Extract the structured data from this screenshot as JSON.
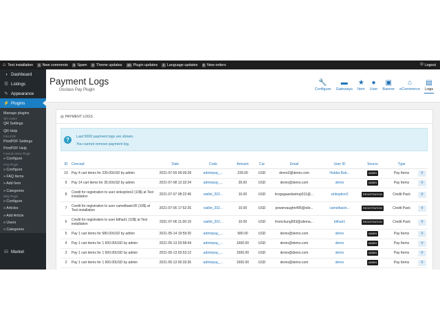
{
  "admin_bar": {
    "site": "Test installation",
    "items": [
      {
        "count": "1",
        "label": "New comments"
      },
      {
        "count": "3",
        "label": "Spam"
      },
      {
        "count": "4",
        "label": "Theme updates"
      },
      {
        "count": "10",
        "label": "Plugin updates"
      },
      {
        "count": "2",
        "label": "Language updates"
      },
      {
        "count": "5",
        "label": "New orders"
      }
    ],
    "logout": "Logout"
  },
  "sidebar": {
    "dashboard": "Dashboard",
    "listings": "Listings",
    "appearance": "Appearance",
    "plugins": "Plugins",
    "submenu": [
      {
        "type": "link",
        "label": "Manage plugins"
      },
      {
        "type": "head",
        "label": "QR Codes"
      },
      {
        "type": "link",
        "label": "QR Settings"
      },
      {
        "type": "link",
        "label": "QR Help"
      },
      {
        "type": "head",
        "label": "Print PDF"
      },
      {
        "type": "link",
        "label": "PrintPDF Settings"
      },
      {
        "type": "link",
        "label": "PrintPDF Help"
      },
      {
        "type": "head",
        "label": "Favorite Items Plugin"
      },
      {
        "type": "link",
        "label": "» Configure"
      },
      {
        "type": "head",
        "label": "FAQ Plugin"
      },
      {
        "type": "link",
        "label": "» Configure"
      },
      {
        "type": "link",
        "label": "» FAQ Items"
      },
      {
        "type": "link",
        "label": "» Add Item"
      },
      {
        "type": "link",
        "label": "» Categories"
      },
      {
        "type": "head",
        "label": "Blog Plugin"
      },
      {
        "type": "link",
        "label": "» Configure"
      },
      {
        "type": "link",
        "label": "» Articles"
      },
      {
        "type": "link",
        "label": "» Add Article"
      },
      {
        "type": "link",
        "label": "» Users"
      },
      {
        "type": "link",
        "label": "» Categories"
      }
    ],
    "market": "Market"
  },
  "header": {
    "title": "Payment Logs",
    "subtitle": "Osclass Pay Plugin",
    "toolbar": [
      {
        "label": "Configure",
        "icon": "wrench-icon",
        "glyph": "🔧"
      },
      {
        "label": "Gateways",
        "icon": "credit-card-icon",
        "glyph": "▬"
      },
      {
        "label": "Item",
        "icon": "star-icon",
        "glyph": "★"
      },
      {
        "label": "User",
        "icon": "user-icon",
        "glyph": "●"
      },
      {
        "label": "Banner",
        "icon": "banner-icon",
        "glyph": "▣"
      },
      {
        "label": "eCommerce",
        "icon": "store-icon",
        "glyph": "⌂"
      },
      {
        "label": "Logs",
        "icon": "logs-icon",
        "glyph": "▤",
        "active": true
      }
    ]
  },
  "panel": {
    "title": "PAYMENT LOGS",
    "info_line1": "Last 5000 payment logs are shown.",
    "info_line2": "You cannot remove payment log."
  },
  "table": {
    "columns": [
      "ID",
      "Concept",
      "Date",
      "Code",
      "Amount",
      "Cur",
      "Email",
      "User ID",
      "Source",
      "Type"
    ],
    "rows": [
      {
        "id": "10",
        "concept": "Pay 4 cart items for 239.00USD by admin",
        "date": "2021-07-09 09:09:28",
        "code": "adminpay_...",
        "amount": "239.00",
        "cur": "USD",
        "email": "demo2@demo.com",
        "user": "Hubba Bub...",
        "source": "ADMIN",
        "type": "Pay Items"
      },
      {
        "id": "9",
        "concept": "Pay 14 cart items for 35.60USD by admin",
        "date": "2021-07-08 12:32:24",
        "code": "adminpay_...",
        "amount": "35.60",
        "cur": "USD",
        "email": "demo@demo.com",
        "user": "demo",
        "source": "ADMIN",
        "type": "Pay Items"
      },
      {
        "id": "8",
        "concept": "Credit for registration to user sinkoption2 (10$) at Test installation",
        "date": "2021-07-07 08:22:46",
        "code": "wallet_202...",
        "amount": "10.00",
        "cur": "USD",
        "email": "krogsgaardastrup511@...",
        "user": "sinkoption2",
        "source": "REGISTRATION",
        "type": "Credit Pack"
      },
      {
        "id": "7",
        "concept": "Credit for registration to user camelbasin35 (10$) at Test installation",
        "date": "2021-07-06 17:52:26",
        "code": "wallet_202...",
        "amount": "10.00",
        "cur": "USD",
        "email": "powervaughn495@sile...",
        "user": "camelbasin...",
        "source": "REGISTRATION",
        "type": "Credit Pack"
      },
      {
        "id": "6",
        "concept": "Credit for registration to user bithair1 (10$) at Test installation",
        "date": "2021-07-06 11:00:19",
        "code": "wallet_202...",
        "amount": "10.00",
        "cur": "USD",
        "email": "fromchung593@silema...",
        "user": "bithair1",
        "source": "REGISTRATION",
        "type": "Credit Pack"
      },
      {
        "id": "5",
        "concept": "Pay 1 cart items for 580.00USD by admin",
        "date": "2021-05-14 19:59:20",
        "code": "adminpay_...",
        "amount": "580.00",
        "cur": "USD",
        "email": "demo@demo.com",
        "user": "demo",
        "source": "ADMIN",
        "type": "Pay Items"
      },
      {
        "id": "4",
        "concept": "Pay 1 cart items for 1 600.00USD by admin",
        "date": "2021-05-13 03:58:44",
        "code": "adminpay_...",
        "amount": "1600.00",
        "cur": "USD",
        "email": "demo@demo.com",
        "user": "demo",
        "source": "ADMIN",
        "type": "Pay Items"
      },
      {
        "id": "3",
        "concept": "Pay 1 cart items for 1 600.00USD by admin",
        "date": "2021-05-13 03:53:12",
        "code": "adminpay_...",
        "amount": "1600.00",
        "cur": "USD",
        "email": "demo@demo.com",
        "user": "demo",
        "source": "ADMIN",
        "type": "Pay Items"
      },
      {
        "id": "2",
        "concept": "Pay 1 cart items for 1 600.00USD by admin",
        "date": "2021-05-13 00:33:35",
        "code": "adminpay_...",
        "amount": "1600.00",
        "cur": "USD",
        "email": "demo@demo.com",
        "user": "demo",
        "source": "ADMIN",
        "type": "Pay Items"
      }
    ]
  }
}
